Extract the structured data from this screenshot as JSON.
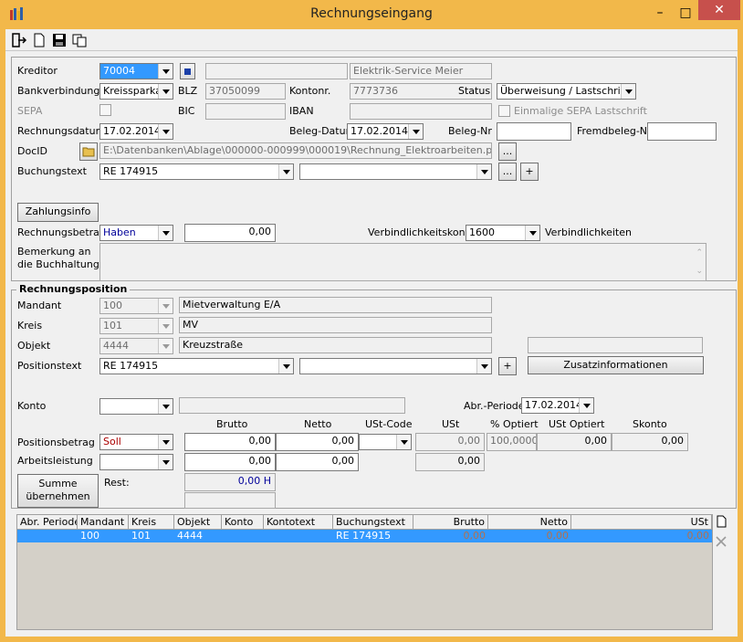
{
  "window": {
    "title": "Rechnungseingang"
  },
  "header": {
    "kreditor_label": "Kreditor",
    "kreditor_value": "70004",
    "kreditor_name": "Elektrik-Service Meier",
    "bank_label": "Bankverbindung",
    "bank_value": "Kreissparkas",
    "blz_label": "BLZ",
    "blz_value": "37050099",
    "kontonr_label": "Kontonr.",
    "kontonr_value": "7773736",
    "status_label": "Status",
    "status_value": "Überweisung / Lastschrift per",
    "sepa_label": "SEPA",
    "bic_label": "BIC",
    "iban_label": "IBAN",
    "sepa_once_label": "Einmalige SEPA Lastschrift",
    "rdatum_label": "Rechnungsdatum",
    "rdatum_value": "17.02.2014",
    "bdatum_label": "Beleg-Datum",
    "bdatum_value": "17.02.2014",
    "belegnr_label": "Beleg-Nr",
    "fremdbeleg_label": "Fremdbeleg-Nr",
    "docid_label": "DocID",
    "docid_value": "E:\\Datenbanken\\Ablage\\000000-000999\\000019\\Rechnung_Elektroarbeiten.pdf",
    "buchungstext_label": "Buchungstext",
    "buchungstext_value": "RE 174915",
    "ellipsis": "...",
    "plus": "+",
    "zahlungsinfo_label": "Zahlungsinfo",
    "rbetrag_label": "Rechnungsbetrag",
    "rbetrag_side": "Haben",
    "rbetrag_value": "0,00",
    "vkonto_label": "Verbindlichkeitskonto",
    "vkonto_value": "1600",
    "vkonto_name": "Verbindlichkeiten",
    "bemerkung_label1": "Bemerkung an",
    "bemerkung_label2": "die Buchhaltung"
  },
  "position": {
    "group_title": "Rechnungsposition",
    "mandant_label": "Mandant",
    "mandant_value": "100",
    "mandant_name": "Mietverwaltung E/A",
    "kreis_label": "Kreis",
    "kreis_value": "101",
    "kreis_name": "MV",
    "objekt_label": "Objekt",
    "objekt_value": "4444",
    "objekt_name": "Kreuzstraße",
    "postext_label": "Positionstext",
    "postext_value": "RE 174915",
    "zusatz_label": "Zusatzinformationen",
    "konto_label": "Konto",
    "abr_label": "Abr.-Periode",
    "abr_value": "17.02.2014",
    "col_brutto": "Brutto",
    "col_netto": "Netto",
    "col_ustcode": "USt-Code",
    "col_ust": "USt",
    "col_optiert": "% Optiert",
    "col_ustoptiert": "USt Optiert",
    "col_skonto": "Skonto",
    "posbetrag_label": "Positionsbetrag",
    "posbetrag_side": "Soll",
    "brutto": "0,00",
    "netto": "0,00",
    "ust": "0,00",
    "optiert": "100,0000",
    "ustoptiert": "0,00",
    "skonto": "0,00",
    "arbeit_label": "Arbeitsleistung",
    "arbeit_brutto": "0,00",
    "arbeit_netto": "0,00",
    "arbeit_ust": "0,00",
    "summe_label1": "Summe",
    "summe_label2": "übernehmen",
    "rest_label": "Rest:",
    "rest_value": "0,00 H"
  },
  "grid": {
    "headers": [
      "Abr. Periode",
      "Mandant",
      "Kreis",
      "Objekt",
      "Konto",
      "Kontotext",
      "Buchungstext",
      "Brutto",
      "Netto",
      "USt"
    ],
    "row": {
      "mandant": "100",
      "kreis": "101",
      "objekt": "4444",
      "buchungstext": "RE 174915",
      "brutto": "0,00",
      "netto": "0,00",
      "ust": "0,00"
    }
  },
  "colors": {
    "titlebar": "#f2b84a",
    "close": "#c7504c",
    "selection": "#3399ff",
    "soll": "#aa0000",
    "haben": "#000099"
  }
}
